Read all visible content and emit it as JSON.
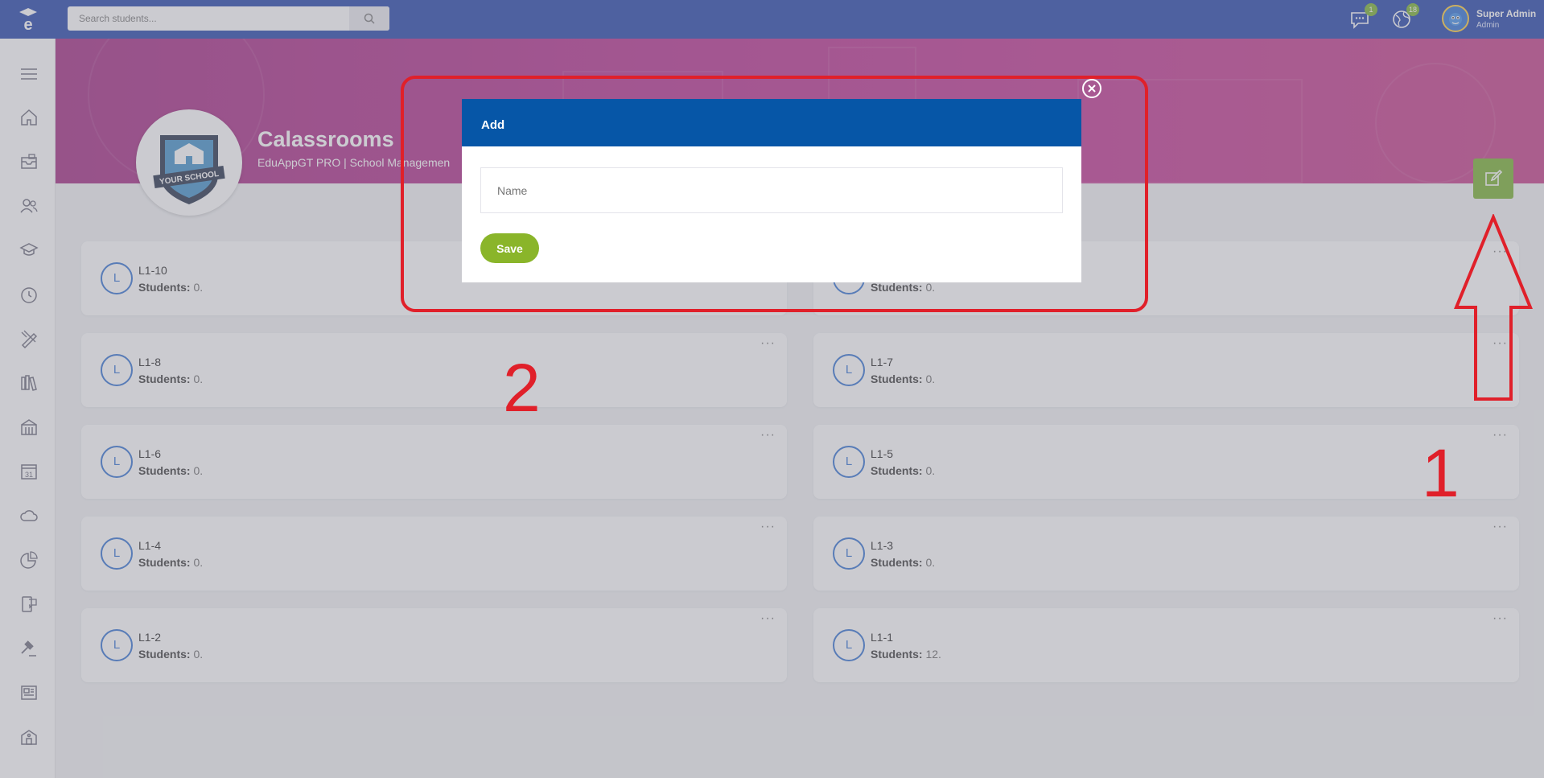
{
  "topbar": {
    "search_placeholder": "Search students...",
    "messages_badge": "1",
    "notifications_badge": "18",
    "user_name": "Super Admin",
    "user_role": "Admin"
  },
  "sidebar": {
    "items": [
      "menu-icon",
      "home-icon",
      "inbox-icon",
      "users-icon",
      "graduation-cap-icon",
      "clock-icon",
      "pencil-ruler-icon",
      "library-icon",
      "building-icon",
      "calendar-icon",
      "cloud-icon",
      "chart-pie-icon",
      "mobile-chat-icon",
      "gavel-icon",
      "newspaper-icon",
      "school-icon"
    ],
    "calendar_number": "31"
  },
  "header": {
    "title": "Calassrooms",
    "subtitle": "EduAppGT PRO | School Managemen",
    "logo_text": "YOUR SCHOOL"
  },
  "classrooms": [
    {
      "initial": "L",
      "name": "L1-10",
      "students_label": "Students:",
      "students_value": "0."
    },
    {
      "initial": "L",
      "name": "",
      "students_label": "Students:",
      "students_value": "0."
    },
    {
      "initial": "L",
      "name": "L1-8",
      "students_label": "Students:",
      "students_value": "0."
    },
    {
      "initial": "L",
      "name": "L1-7",
      "students_label": "Students:",
      "students_value": "0."
    },
    {
      "initial": "L",
      "name": "L1-6",
      "students_label": "Students:",
      "students_value": "0."
    },
    {
      "initial": "L",
      "name": "L1-5",
      "students_label": "Students:",
      "students_value": "0."
    },
    {
      "initial": "L",
      "name": "L1-4",
      "students_label": "Students:",
      "students_value": "0."
    },
    {
      "initial": "L",
      "name": "L1-3",
      "students_label": "Students:",
      "students_value": "0."
    },
    {
      "initial": "L",
      "name": "L1-2",
      "students_label": "Students:",
      "students_value": "0."
    },
    {
      "initial": "L",
      "name": "L1-1",
      "students_label": "Students:",
      "students_value": "12."
    }
  ],
  "card_menu": "···",
  "modal": {
    "title": "Add",
    "name_placeholder": "Name",
    "save_label": "Save"
  },
  "annotations": {
    "step1": "1",
    "step2": "2",
    "color": "#e0202a"
  }
}
